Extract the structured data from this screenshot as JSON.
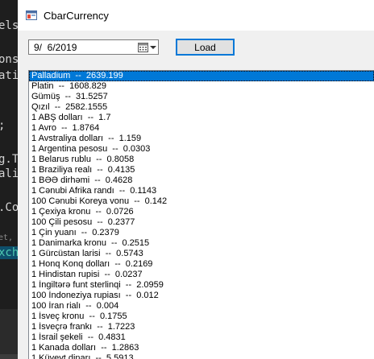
{
  "window": {
    "title": "CbarCurrency"
  },
  "controls": {
    "date_value": "9/  6/2019",
    "load_label": "Load"
  },
  "background_editor": {
    "lines": [
      "els",
      "ons",
      "ati",
      ";",
      "g.T",
      "ali",
      ".Co",
      "et, I",
      "xch"
    ]
  },
  "currency_list": {
    "selected_index": 0,
    "items": [
      "Palladium  --  2639.199",
      "Platin  --  1608.829",
      "Gümüş  --  31.5257",
      "Qızıl  --  2582.1555",
      "1 ABŞ dolları  --  1.7",
      "1 Avro  --  1.8764",
      "1 Avstraliya dolları  --  1.159",
      "1 Argentina pesosu  --  0.0303",
      "1 Belarus rublu  --  0.8058",
      "1 Braziliya realı  --  0.4135",
      "1 BƏƏ dirhəmi  --  0.4628",
      "1 Cənubi Afrika randı  --  0.1143",
      "100 Cənubi Koreya vonu  --  0.142",
      "1 Çexiya kronu  --  0.0726",
      "100 Çili pesosu  --  0.2377",
      "1 Çin yuanı  --  0.2379",
      "1 Danimarka kronu  --  0.2515",
      "1 Gürcüstan larisi  --  0.5743",
      "1 Honq Konq dolları  --  0.2169",
      "1 Hindistan rupisi  --  0.0237",
      "1 İngiltərə funt sterlinqi  --  2.0959",
      "100 İndoneziya rupiası  --  0.012",
      "100 İran rialı  --  0.004",
      "1 İsveç kronu  --  0.1755",
      "1 İsveçrə frankı  --  1.7223",
      "1 İsrail şekeli  --  0.4831",
      "1 Kanada dolları  --  1.2863",
      "1 Küveyt dinarı  --  5.5913"
    ]
  },
  "colors": {
    "selection": "#0078d7",
    "window_bg": "#f0f0f0",
    "editor_bg": "#1e1e1e"
  }
}
